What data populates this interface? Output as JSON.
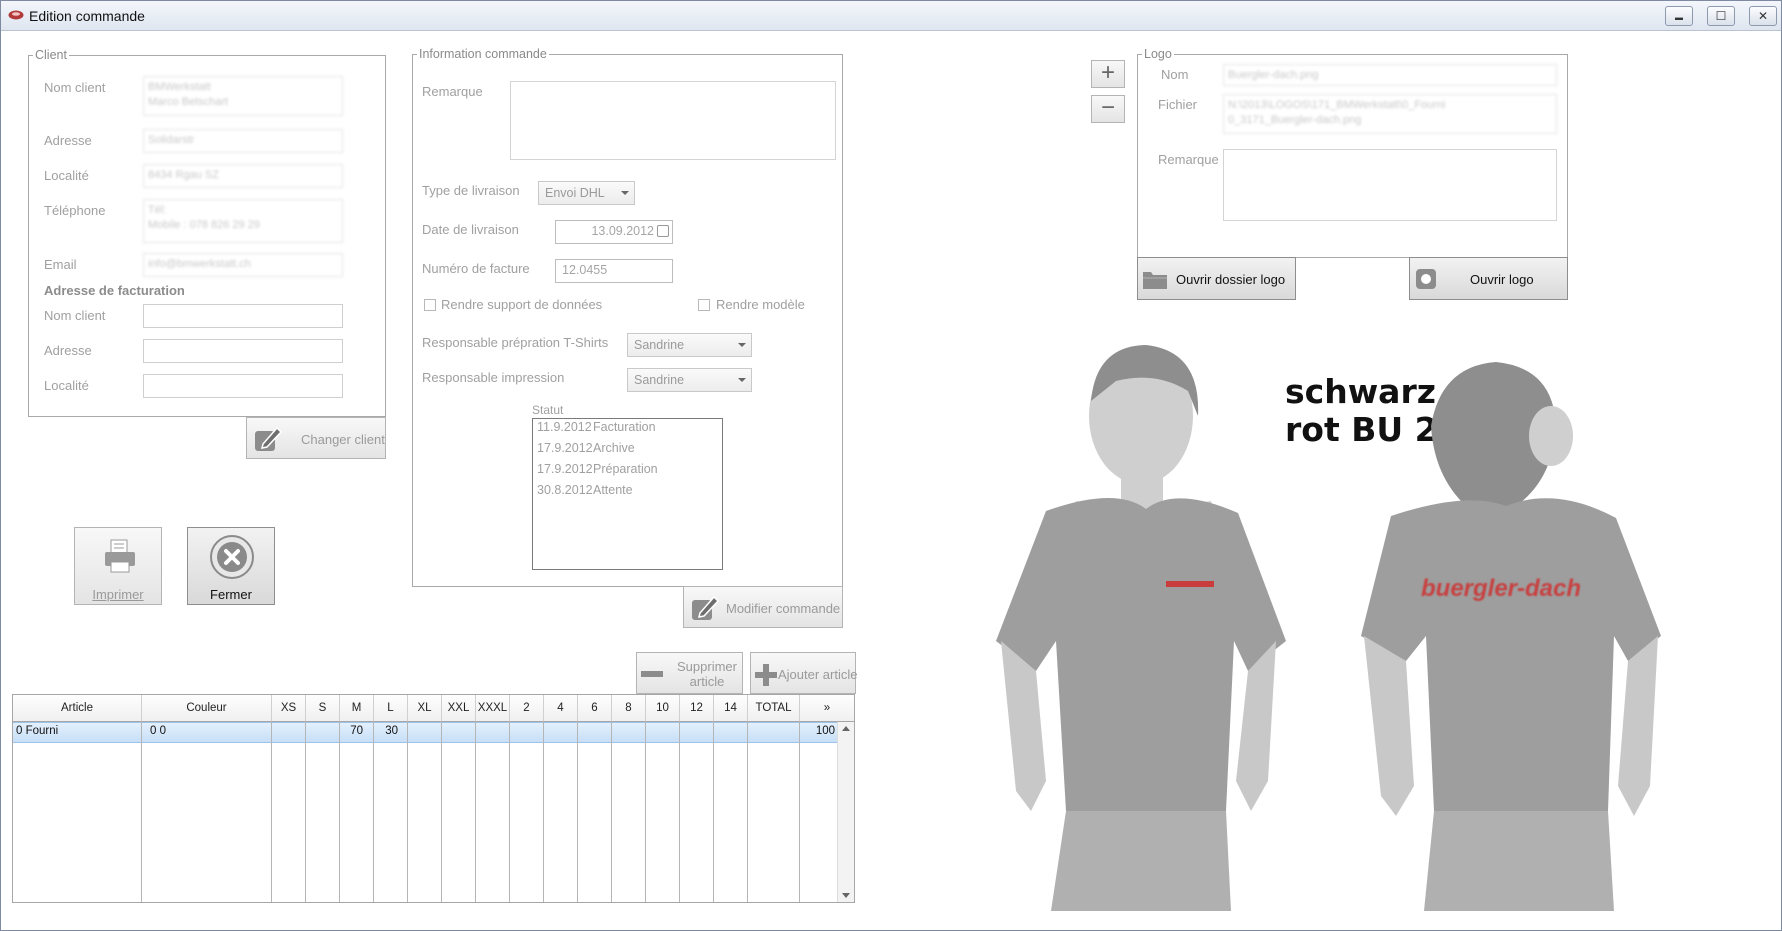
{
  "window": {
    "title": "Edition commande",
    "minimize": "▬",
    "maximize": "☐",
    "close": "✕"
  },
  "client": {
    "legend": "Client",
    "nom_label": "Nom client",
    "nom_value_line1": "BMWerkstatt",
    "nom_value_line2": "Marco Betschart",
    "adresse_label": "Adresse",
    "adresse_value": "Solidarstr",
    "localite_label": "Localité",
    "localite_value": "8434 Rgau SZ",
    "telephone_label": "Téléphone",
    "telephone_value_line1": "Tél:",
    "telephone_value_line2": "Mobile : 078 826 29 29",
    "email_label": "Email",
    "email_value": "info@bmwerkstatt.ch",
    "facturation_heading": "Adresse de facturation",
    "fact_nom_label": "Nom client",
    "fact_adresse_label": "Adresse",
    "fact_localite_label": "Localité",
    "changer_client": "Changer client"
  },
  "commande": {
    "legend": "Information commande",
    "remarque_label": "Remarque",
    "type_livraison_label": "Type de livraison",
    "type_livraison_value": "Envoi DHL",
    "date_livraison_label": "Date de livraison",
    "date_livraison_value": "13.09.2012",
    "numero_facture_label": "Numéro de facture",
    "numero_facture_value": "12.0455",
    "rendre_support": "Rendre support de données",
    "rendre_modele": "Rendre modèle",
    "resp_preparation_label": "Responsable prépration T-Shirts",
    "resp_preparation_value": "Sandrine",
    "resp_impression_label": "Responsable impression",
    "resp_impression_value": "Sandrine",
    "statut_label": "Statut",
    "statut": [
      {
        "date": "11.9.2012",
        "state": "Facturation"
      },
      {
        "date": "17.9.2012",
        "state": "Archive"
      },
      {
        "date": "17.9.2012",
        "state": "Préparation"
      },
      {
        "date": "30.8.2012",
        "state": "Attente"
      }
    ],
    "modifier_commande": "Modifier commande"
  },
  "actions": {
    "imprimer": "Imprimer",
    "fermer": "Fermer",
    "supprimer_line1": "Supprimer",
    "supprimer_line2": "article",
    "ajouter": "Ajouter article"
  },
  "grid": {
    "columns": [
      "Article",
      "Couleur",
      "XS",
      "S",
      "M",
      "L",
      "XL",
      "XXL",
      "XXXL",
      "2",
      "4",
      "6",
      "8",
      "10",
      "12",
      "14",
      "TOTAL"
    ],
    "more": "»",
    "rows": [
      {
        "article": "0 Fourni",
        "couleur": "0 0",
        "M": "70",
        "L": "30",
        "total": "100"
      }
    ]
  },
  "logo": {
    "legend": "Logo",
    "nom_label": "Nom",
    "nom_value": "Buergler-dach.png",
    "fichier_label": "Fichier",
    "fichier_value_line1": "N:\\2013\\LOGOS\\171_BMWerkstatt\\0_Fourni",
    "fichier_value_line2": "0_3171_Buergler-dach.png",
    "remarque_label": "Remarque",
    "ouvrir_dossier": "Ouvrir dossier logo",
    "ouvrir_logo": "Ouvrir logo",
    "add": "+",
    "remove": "−"
  },
  "preview": {
    "color_line1": "schwarz",
    "color_line2": "rot BU 21",
    "front_logo": "buergler-dach",
    "back_logo": "buergler-dach",
    "shirt_color": "#9e9e9e",
    "logo_color": "#d12b2b"
  }
}
